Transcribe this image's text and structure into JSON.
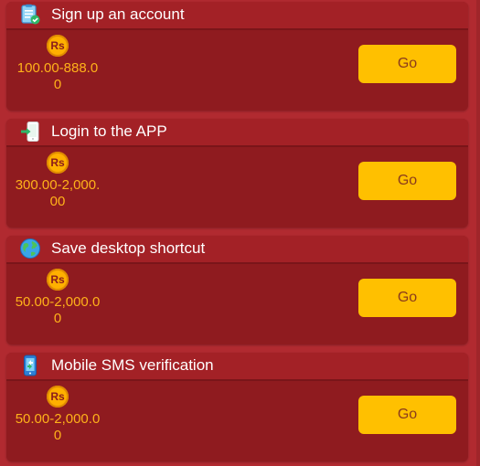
{
  "currency_symbol": "Rs",
  "button_label": "Go",
  "colors": {
    "page_background": "#b12a30",
    "card_background": "#8f1b1f",
    "header_background": "#a32126",
    "amount_text": "#ffb21a",
    "button_background": "#ffc000",
    "button_text": "#8a3b1c",
    "coin": "#ffb000"
  },
  "tasks": [
    {
      "title": "Sign up an account",
      "icon": "clipboard-check-icon",
      "amount": "100.00-888.00"
    },
    {
      "title": "Login to the APP",
      "icon": "phone-login-icon",
      "amount": "300.00-2,000.00"
    },
    {
      "title": "Save desktop shortcut",
      "icon": "globe-icon",
      "amount": "50.00-2,000.00"
    },
    {
      "title": "Mobile SMS verification",
      "icon": "mobile-sms-icon",
      "amount": "50.00-2,000.00"
    }
  ]
}
